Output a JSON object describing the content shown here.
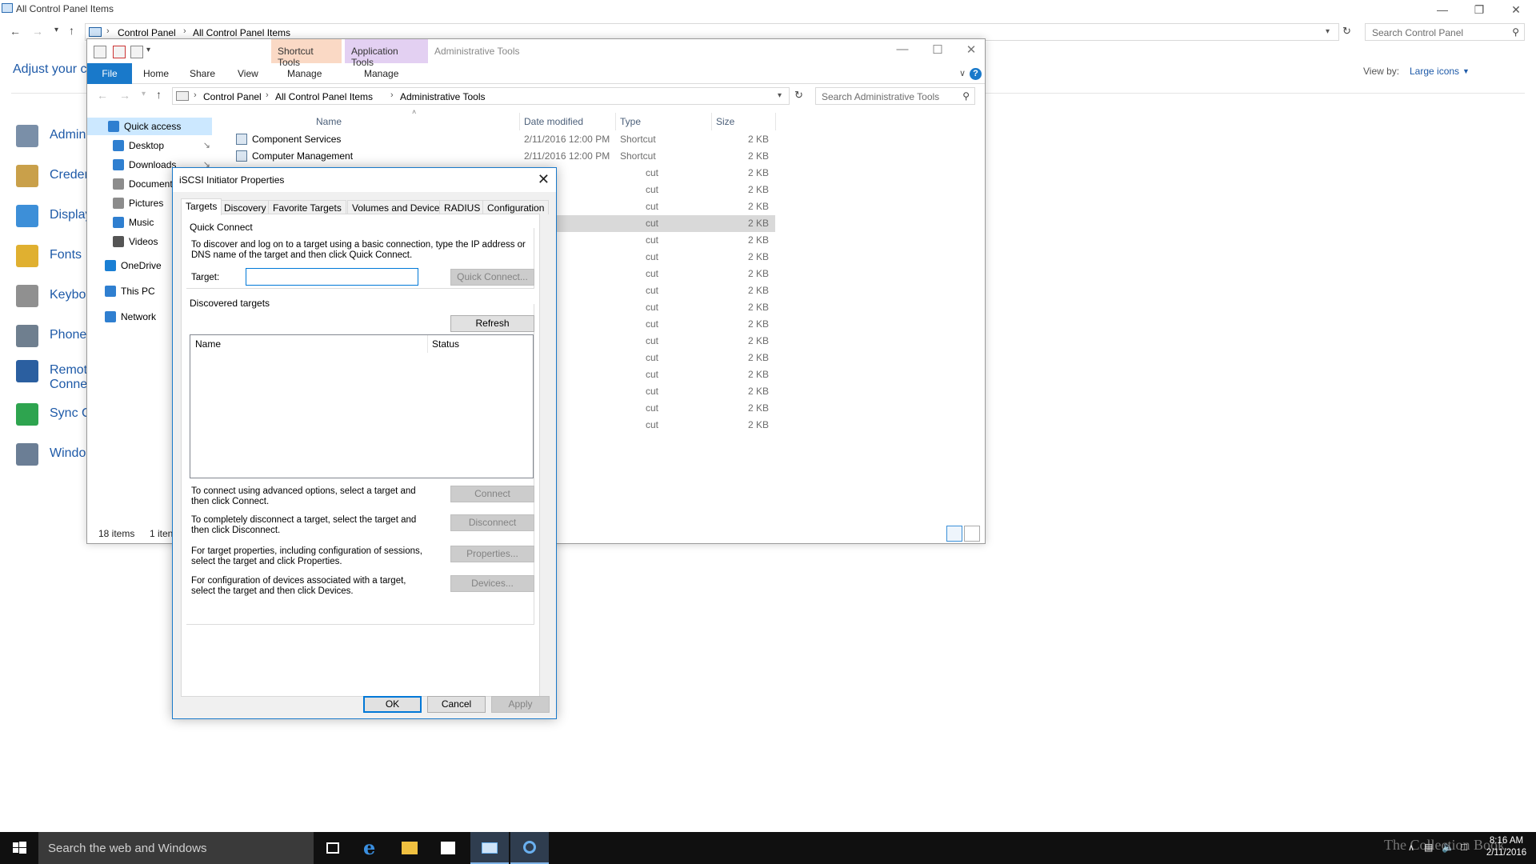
{
  "control_panel": {
    "title": "All Control Panel Items",
    "breadcrumb": [
      "Control Panel",
      "All Control Panel Items"
    ],
    "search_placeholder": "Search Control Panel",
    "heading": "Adjust your c",
    "view_by_label": "View by:",
    "view_by_value": "Large icons",
    "items": [
      {
        "label": "Admin",
        "color": "#7a8fa8"
      },
      {
        "label": "Creder",
        "color": "#c9a04a"
      },
      {
        "label": "Display",
        "color": "#3d8fd8"
      },
      {
        "label": "Fonts",
        "color": "#e0b030"
      },
      {
        "label": "Keyboa",
        "color": "#909090"
      },
      {
        "label": "Phone",
        "color": "#6f7f8f"
      },
      {
        "label": "Remot",
        "label2": "Conne",
        "color": "#2b5fa0"
      },
      {
        "label": "Sync C",
        "color": "#2ea44f"
      },
      {
        "label": "Windo",
        "color": "#6b7e95"
      }
    ]
  },
  "explorer": {
    "title": "Administrative Tools",
    "context_tabs": {
      "shortcut": "Shortcut Tools",
      "application": "Application Tools"
    },
    "ribbon_tabs": [
      "File",
      "Home",
      "Share",
      "View",
      "Manage",
      "Manage"
    ],
    "breadcrumb": [
      "Control Panel",
      "All Control Panel Items",
      "Administrative Tools"
    ],
    "search_placeholder": "Search Administrative Tools",
    "nav": [
      {
        "label": "Quick access",
        "color": "#2f7fd0"
      },
      {
        "label": "Desktop",
        "color": "#2f7fd0"
      },
      {
        "label": "Downloads",
        "color": "#2f7fd0"
      },
      {
        "label": "Document",
        "color": "#8c8c8c"
      },
      {
        "label": "Pictures",
        "color": "#8c8c8c"
      },
      {
        "label": "Music",
        "color": "#2f7fd0"
      },
      {
        "label": "Videos",
        "color": "#555555"
      },
      {
        "label": "OneDrive",
        "color": "#1a7fd4"
      },
      {
        "label": "This PC",
        "color": "#2f7fd0"
      },
      {
        "label": "Network",
        "color": "#2f7fd0"
      }
    ],
    "columns": [
      "Name",
      "Date modified",
      "Type",
      "Size"
    ],
    "files": [
      {
        "name": "Component Services",
        "date": "2/11/2016 12:00 PM",
        "type": "Shortcut",
        "size": "2 KB"
      },
      {
        "name": "Computer Management",
        "date": "2/11/2016 12:00 PM",
        "type": "Shortcut",
        "size": "2 KB"
      }
    ],
    "hidden_row_type_fragment": "cut",
    "hidden_row_size": "2 KB",
    "status_items": "18 items",
    "status_selected": "1 iten"
  },
  "dialog": {
    "title": "iSCSI Initiator Properties",
    "tabs": [
      "Targets",
      "Discovery",
      "Favorite Targets",
      "Volumes and Devices",
      "RADIUS",
      "Configuration"
    ],
    "quick_connect": {
      "label": "Quick Connect",
      "description": "To discover and log on to a target using a basic connection, type the IP address or DNS name of the target and then click Quick Connect.",
      "target_label": "Target:",
      "target_value": "",
      "button": "Quick Connect..."
    },
    "discovered": {
      "label": "Discovered targets",
      "refresh": "Refresh",
      "columns": [
        "Name",
        "Status"
      ]
    },
    "actions": [
      {
        "text": "To connect using advanced options, select a target and then click Connect.",
        "button": "Connect"
      },
      {
        "text": "To completely disconnect a target, select the target and then click Disconnect.",
        "button": "Disconnect"
      },
      {
        "text": "For target properties, including configuration of sessions, select the target and click Properties.",
        "button": "Properties..."
      },
      {
        "text": "For configuration of devices associated with a target, select the target and then click Devices.",
        "button": "Devices..."
      }
    ],
    "footer": {
      "ok": "OK",
      "cancel": "Cancel",
      "apply": "Apply"
    }
  },
  "taskbar": {
    "search_placeholder": "Search the web and Windows",
    "watermark": "The Collection Book",
    "time": "8:16 AM",
    "date": "2/11/2016"
  }
}
